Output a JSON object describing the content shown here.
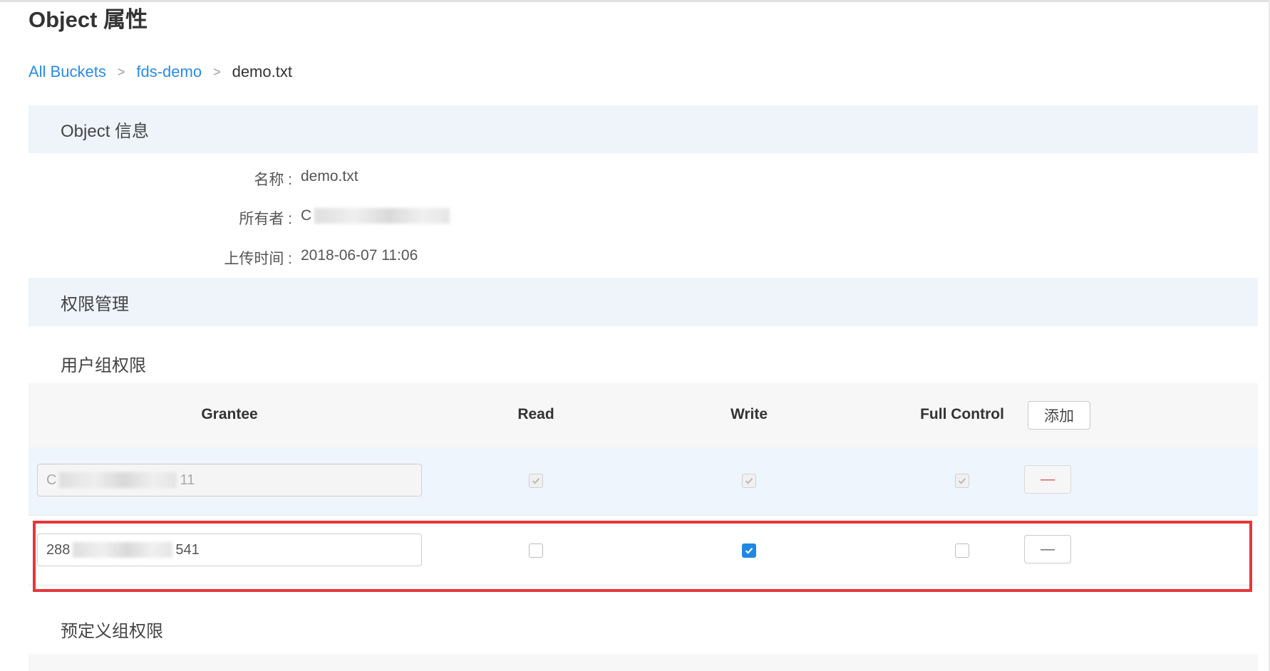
{
  "page": {
    "title": "Object 属性"
  },
  "breadcrumb": {
    "items": [
      {
        "label": "All Buckets"
      },
      {
        "label": "fds-demo"
      },
      {
        "label": "demo.txt"
      }
    ],
    "separator": ">"
  },
  "object_info": {
    "header": "Object 信息",
    "name_label": "名称 :",
    "name_value": "demo.txt",
    "owner_label": "所有者 :",
    "owner_value_prefix": "C",
    "upload_label": "上传时间 :",
    "upload_value": "2018-06-07 11:06"
  },
  "permissions": {
    "header": "权限管理",
    "user_group_title": "用户组权限",
    "predefined_group_title": "预定义组权限",
    "columns": {
      "grantee": "Grantee",
      "read": "Read",
      "write": "Write",
      "full_control": "Full Control"
    },
    "add_button": "添加",
    "minus_label": "—",
    "rows": [
      {
        "grantee_prefix": "C",
        "grantee_suffix": "11",
        "read": true,
        "write": true,
        "full_control": true,
        "disabled": true
      },
      {
        "grantee_prefix": "288",
        "grantee_suffix": "541",
        "read": false,
        "write": true,
        "full_control": false,
        "disabled": false
      }
    ]
  },
  "colors": {
    "link": "#2a8be6",
    "section_bg": "#eef4fa",
    "checkbox_checked": "#1e88e5",
    "highlight_box": "#e8363a"
  }
}
